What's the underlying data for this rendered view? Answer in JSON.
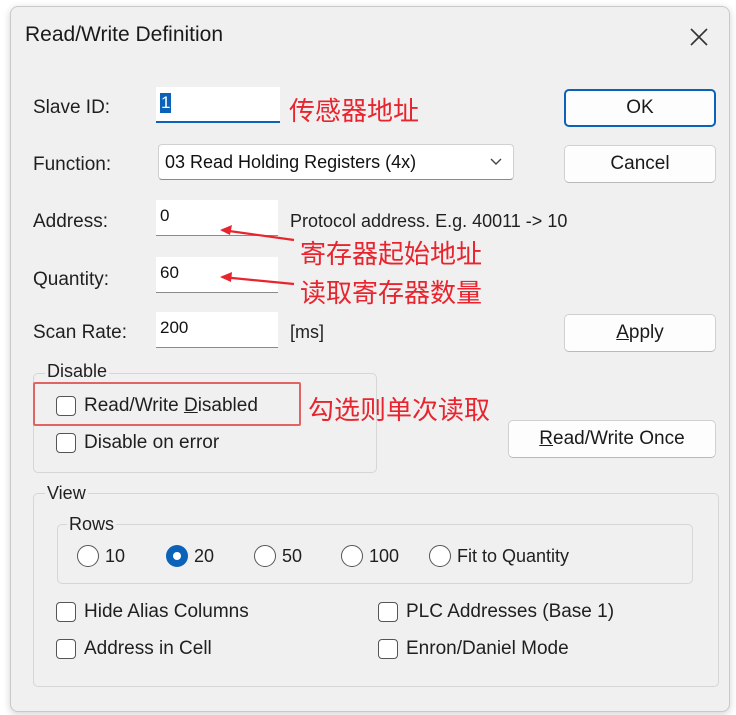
{
  "window": {
    "title": "Read/Write Definition"
  },
  "fields": {
    "slave_id": {
      "label": "Slave ID:",
      "value": "1"
    },
    "function": {
      "label": "Function:",
      "value": "03 Read Holding Registers (4x)"
    },
    "address": {
      "label": "Address:",
      "value": "0",
      "hint": "Protocol address. E.g. 40011 -> 10"
    },
    "quantity": {
      "label": "Quantity:",
      "value": "60"
    },
    "scan_rate": {
      "label": "Scan Rate:",
      "value": "200",
      "unit": "[ms]"
    }
  },
  "buttons": {
    "ok": "OK",
    "cancel": "Cancel",
    "apply_pre": "",
    "apply_key": "A",
    "apply_post": "pply",
    "once_key": "R",
    "once_post": "ead/Write Once"
  },
  "disable": {
    "title": "Disable",
    "rw_disabled_pre": "Read/Write ",
    "rw_disabled_key": "D",
    "rw_disabled_post": "isabled",
    "on_error": "Disable on error"
  },
  "view": {
    "title": "View",
    "rows": {
      "title": "Rows",
      "options": [
        "10",
        "20",
        "50",
        "100",
        "Fit to Quantity"
      ],
      "selected": "20"
    },
    "hide_alias": "Hide Alias Columns",
    "plc_addresses": "PLC Addresses (Base 1)",
    "address_in_cell": "Address in Cell",
    "enron_mode": "Enron/Daniel Mode"
  },
  "annotations": {
    "slave_id": "传感器地址",
    "address": "寄存器起始地址",
    "quantity": "读取寄存器数量",
    "disabled": "勾选则单次读取"
  },
  "colors": {
    "accent": "#0a63b8",
    "annotation": "#e8252e"
  }
}
